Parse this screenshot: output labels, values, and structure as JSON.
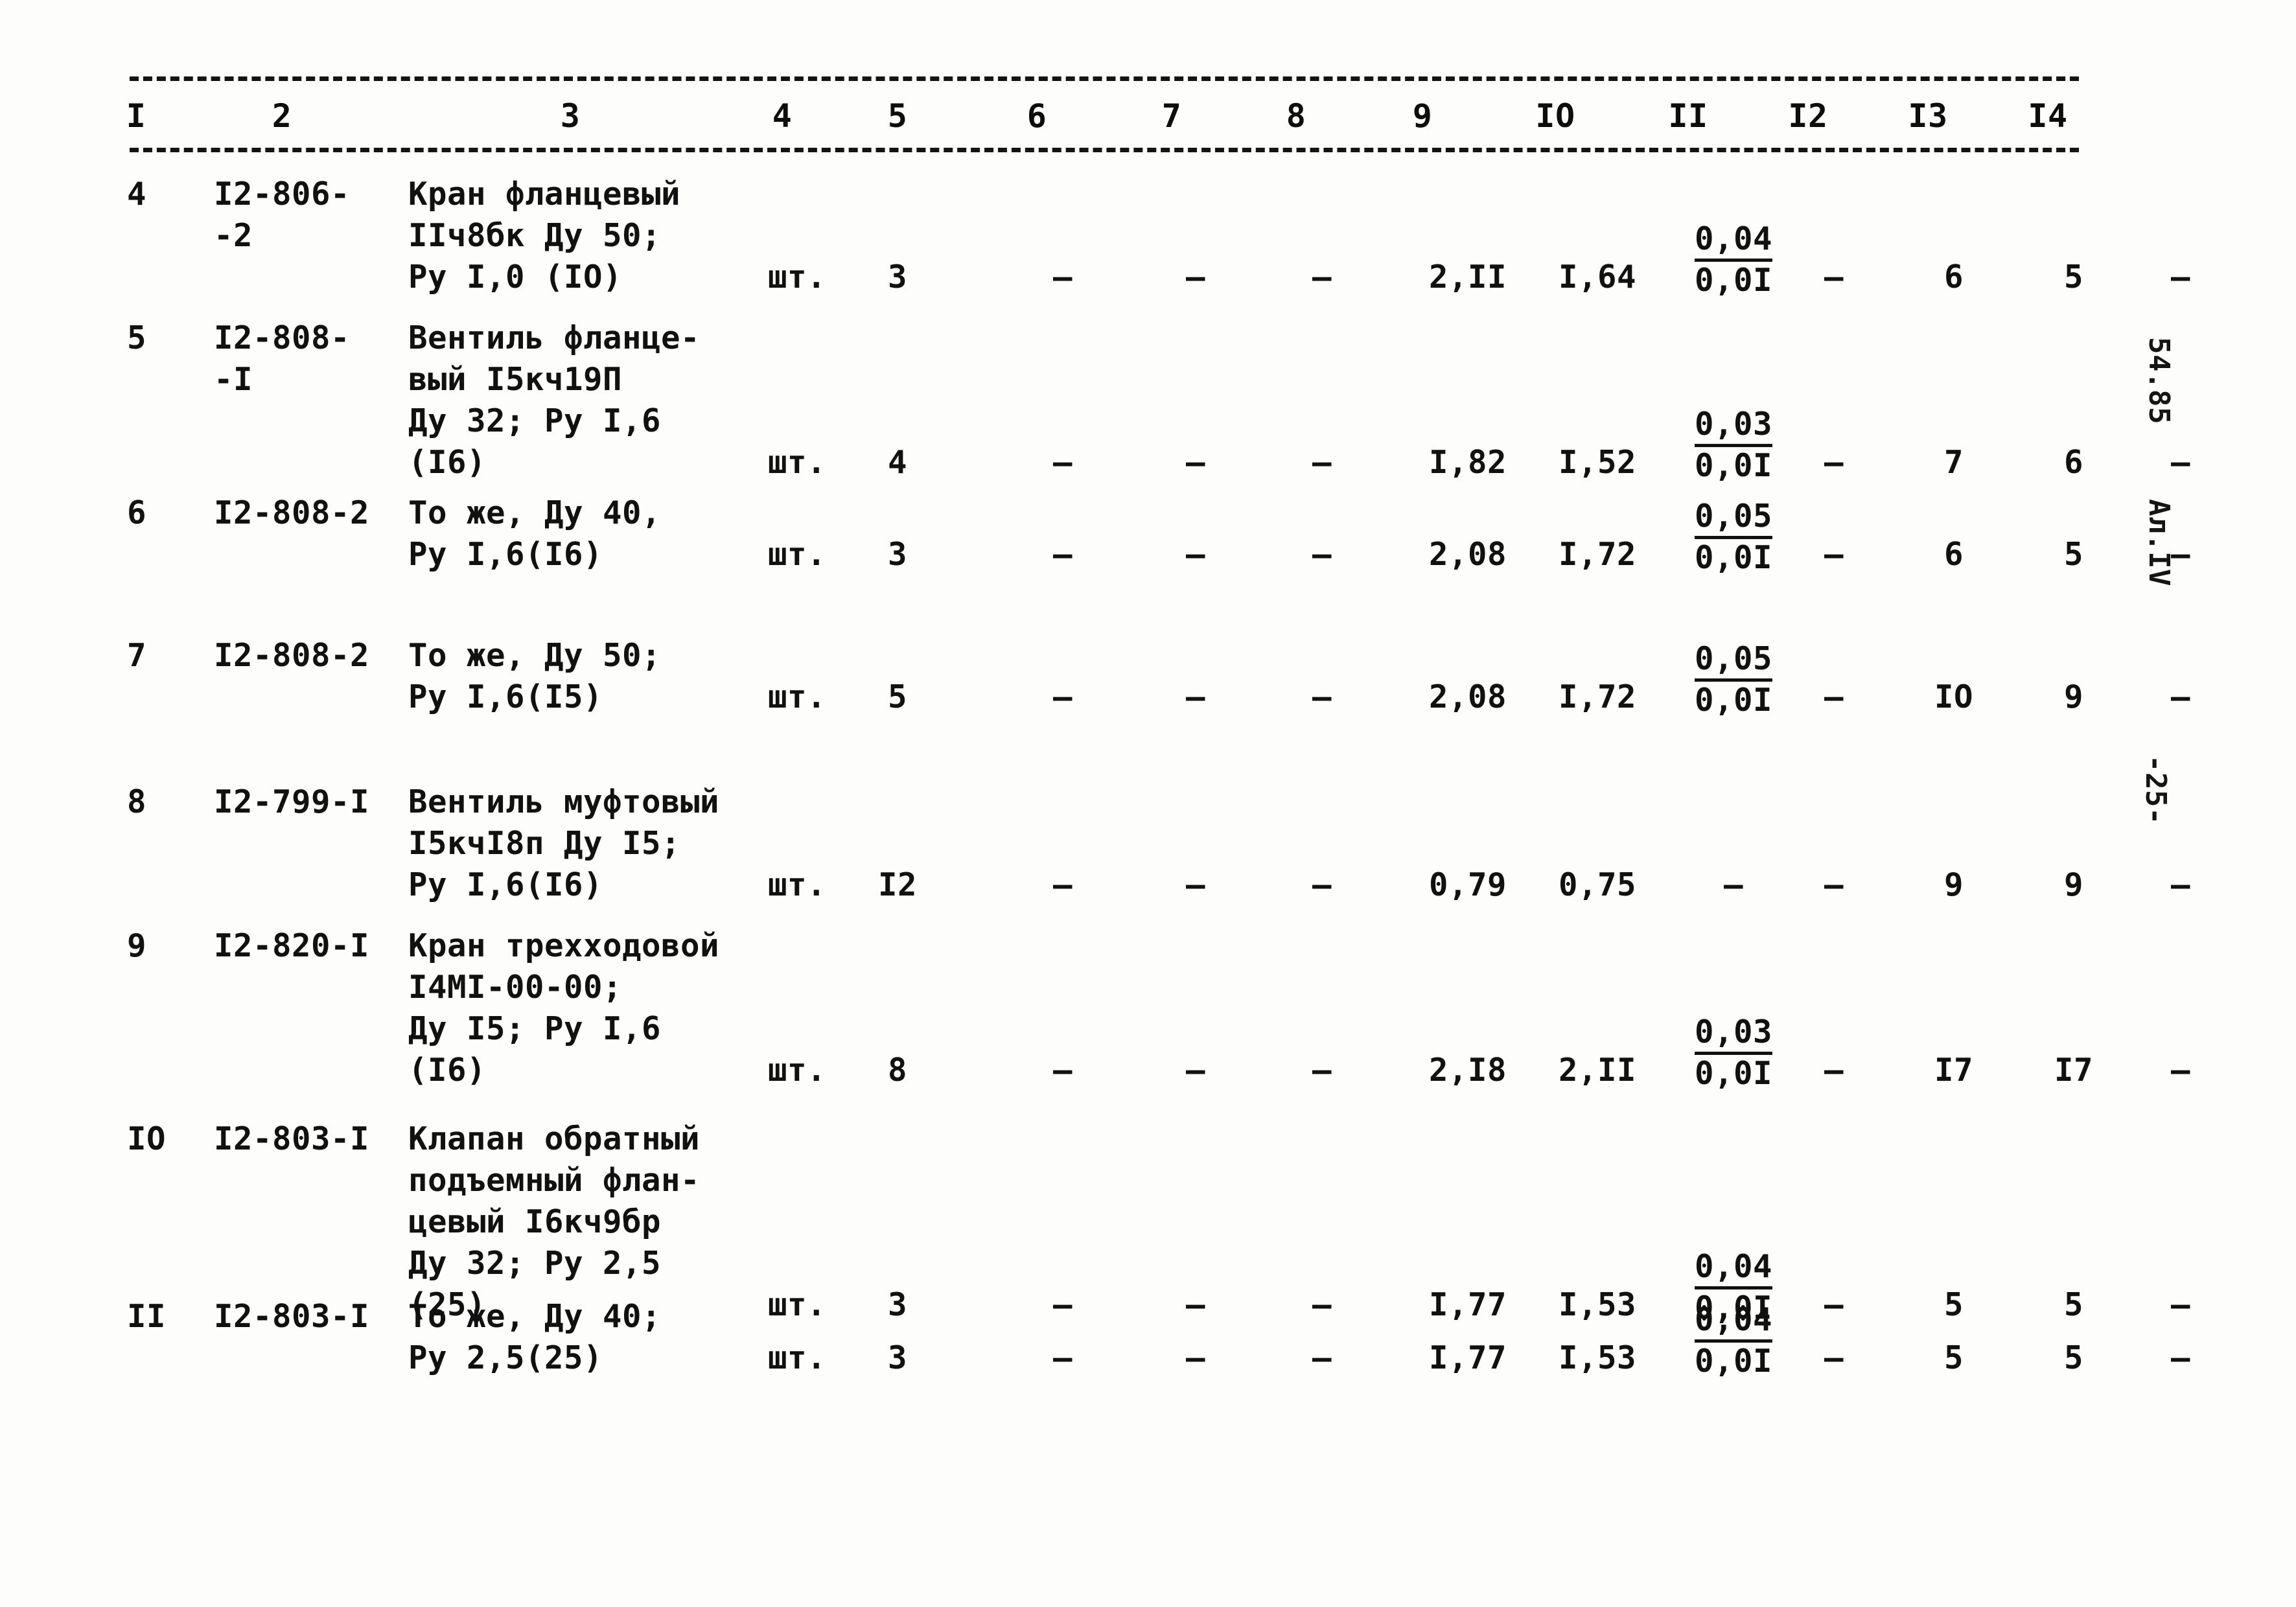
{
  "document": {
    "type": "scanned-typewritten-table",
    "side_marks": {
      "code": "54.85",
      "album": "Ал.IV",
      "page": "-25-"
    }
  },
  "table": {
    "column_headers": [
      "I",
      "2",
      "3",
      "4",
      "5",
      "6",
      "7",
      "8",
      "9",
      "IO",
      "II",
      "I2",
      "I3",
      "I4"
    ],
    "rows": [
      {
        "no": "4",
        "code_line1": "I2-806-",
        "code_line2": "-2",
        "desc_line1": "Кран фланцевый",
        "desc_line2": "IIч8бк Ду 50;",
        "desc_line3": "Ру I,0 (IO)",
        "desc_line4": "",
        "unit": "шт.",
        "qty": "3",
        "c6": "–",
        "c7": "–",
        "c8": "–",
        "c9": "2,II",
        "c10": "I,64",
        "c11_num": "0,04",
        "c11_den": "0,0I",
        "c12": "–",
        "c13": "6",
        "c14": "5",
        "c15": "–"
      },
      {
        "no": "5",
        "code_line1": "I2-808-",
        "code_line2": "-I",
        "desc_line1": "Вентиль фланце-",
        "desc_line2": "вый I5кч19П",
        "desc_line3": "Ду 32; Ру I,6",
        "desc_line4": "(I6)",
        "unit": "шт.",
        "qty": "4",
        "c6": "–",
        "c7": "–",
        "c8": "–",
        "c9": "I,82",
        "c10": "I,52",
        "c11_num": "0,03",
        "c11_den": "0,0I",
        "c12": "–",
        "c13": "7",
        "c14": "6",
        "c15": "–"
      },
      {
        "no": "6",
        "code_line1": "I2-808-2",
        "code_line2": "",
        "desc_line1": "То же, Ду 40,",
        "desc_line2": "Ру I,6(I6)",
        "desc_line3": "",
        "desc_line4": "",
        "unit": "шт.",
        "qty": "3",
        "c6": "–",
        "c7": "–",
        "c8": "–",
        "c9": "2,08",
        "c10": "I,72",
        "c11_num": "0,05",
        "c11_den": "0,0I",
        "c12": "–",
        "c13": "6",
        "c14": "5",
        "c15": "–"
      },
      {
        "no": "7",
        "code_line1": "I2-808-2",
        "code_line2": "",
        "desc_line1": "То же, Ду 50;",
        "desc_line2": "Ру I,6(I5)",
        "desc_line3": "",
        "desc_line4": "",
        "unit": "шт.",
        "qty": "5",
        "c6": "–",
        "c7": "–",
        "c8": "–",
        "c9": "2,08",
        "c10": "I,72",
        "c11_num": "0,05",
        "c11_den": "0,0I",
        "c12": "–",
        "c13": "IO",
        "c14": "9",
        "c15": "–"
      },
      {
        "no": "8",
        "code_line1": "I2-799-I",
        "code_line2": "",
        "desc_line1": "Вентиль муфтовый",
        "desc_line2": "I5кчI8п Ду I5;",
        "desc_line3": "Ру I,6(I6)",
        "desc_line4": "",
        "unit": "шт.",
        "qty": "I2",
        "c6": "–",
        "c7": "–",
        "c8": "–",
        "c9": "0,79",
        "c10": "0,75",
        "c11_num": "",
        "c11_den": "–",
        "c12": "–",
        "c13": "9",
        "c14": "9",
        "c15": "–"
      },
      {
        "no": "9",
        "code_line1": "I2-820-I",
        "code_line2": "",
        "desc_line1": "Кран трехходовой",
        "desc_line2": "I4МI-00-00;",
        "desc_line3": "Ду I5; Ру I,6",
        "desc_line4": "(I6)",
        "unit": "шт.",
        "qty": "8",
        "c6": "–",
        "c7": "–",
        "c8": "–",
        "c9": "2,I8",
        "c10": "2,II",
        "c11_num": "0,03",
        "c11_den": "0,0I",
        "c12": "–",
        "c13": "I7",
        "c14": "I7",
        "c15": "–"
      },
      {
        "no": "IO",
        "code_line1": "I2-803-I",
        "code_line2": "",
        "desc_line1": "Клапан обратный",
        "desc_line2": "подъемный флан-",
        "desc_line3": "цевый I6кч9бр",
        "desc_line4": "Ду 32; Ру 2,5",
        "desc_line5": "(25)",
        "unit": "шт.",
        "qty": "3",
        "c6": "–",
        "c7": "–",
        "c8": "–",
        "c9": "I,77",
        "c10": "I,53",
        "c11_num": "0,04",
        "c11_den": "0,0I",
        "c12": "–",
        "c13": "5",
        "c14": "5",
        "c15": "–"
      },
      {
        "no": "II",
        "code_line1": "I2-803-I",
        "code_line2": "",
        "desc_line1": "То же, Ду 40;",
        "desc_line2": "Ру 2,5(25)",
        "desc_line3": "",
        "desc_line4": "",
        "unit": "шт.",
        "qty": "3",
        "c6": "–",
        "c7": "–",
        "c8": "–",
        "c9": "I,77",
        "c10": "I,53",
        "c11_num": "0,04",
        "c11_den": "0,0I",
        "c12": "–",
        "c13": "5",
        "c14": "5",
        "c15": "–"
      }
    ]
  }
}
